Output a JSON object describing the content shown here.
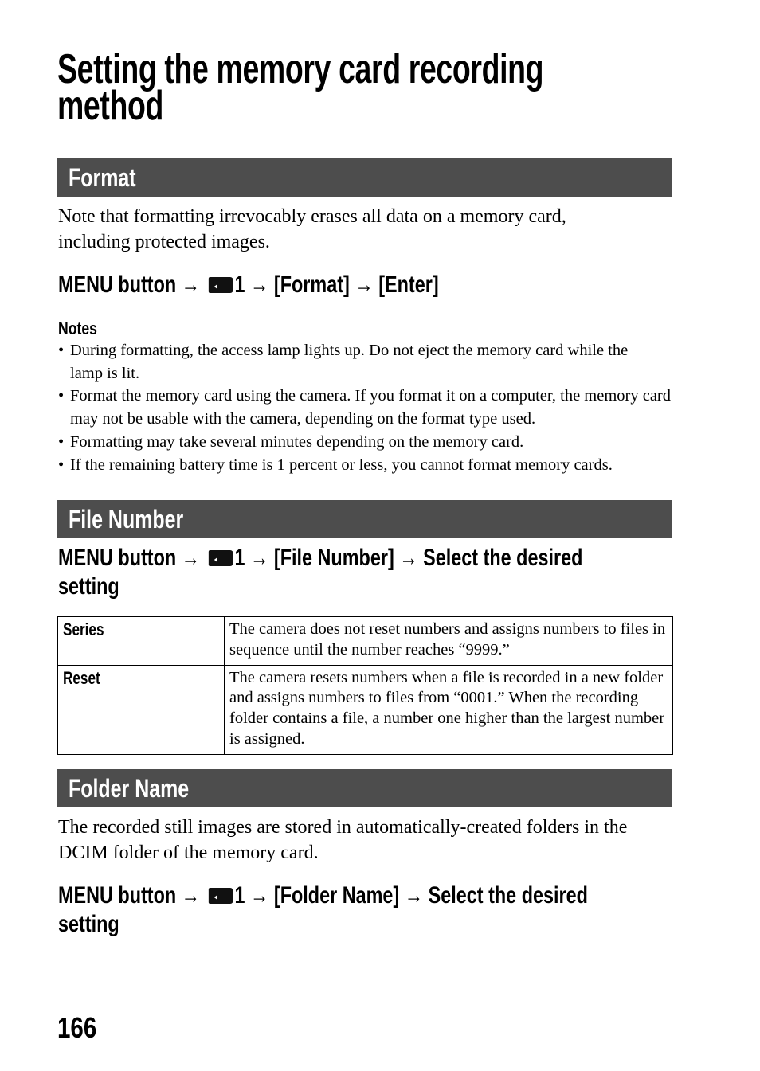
{
  "page": {
    "title_line1": "Setting the memory card recording",
    "title_line2": "method",
    "page_number": "166"
  },
  "sections": {
    "format": {
      "heading": "Format",
      "intro_line1": "Note that formatting irrevocably erases all data on a memory card,",
      "intro_line2": "including protected images.",
      "step": {
        "prefix": "MENU button →",
        "icon": "memory-card-icon",
        "tab_number": "1",
        "rest": "→ [Format] → [Enter]"
      },
      "notes_heading": "Notes",
      "notes": [
        "During formatting, the access lamp lights up. Do not eject the memory card while the lamp is lit.",
        "Format the memory card using the camera. If you format it on a computer, the memory card may not be usable with the camera, depending on the format type used.",
        "Formatting may take several minutes depending on the memory card.",
        "If the remaining battery time is 1 percent or less, you cannot format memory cards."
      ]
    },
    "file_number": {
      "heading": "File Number",
      "step": {
        "prefix": "MENU button →",
        "icon": "memory-card-icon",
        "tab_number": "1",
        "rest": "→ [File Number] → Select the desired",
        "line2": "setting"
      },
      "options": [
        {
          "name": "Series",
          "description": "The camera does not reset numbers and assigns numbers to files in sequence until the number reaches “9999.”"
        },
        {
          "name": "Reset",
          "description": "The camera resets numbers when a file is recorded in a new folder and assigns numbers to files from “0001.” When the recording folder contains a file, a number one higher than the largest number is assigned."
        }
      ]
    },
    "folder_name": {
      "heading": "Folder Name",
      "intro_line1": "The recorded still images are stored in automatically-created folders in the",
      "intro_line2": "DCIM folder of the memory card.",
      "step": {
        "prefix": "MENU button →",
        "icon": "memory-card-icon",
        "tab_number": "1",
        "rest": "→ [Folder Name] → Select the desired",
        "line2": "setting"
      }
    }
  },
  "colors": {
    "section_bar": "#4d4d4d",
    "section_text": "#ffffff"
  }
}
